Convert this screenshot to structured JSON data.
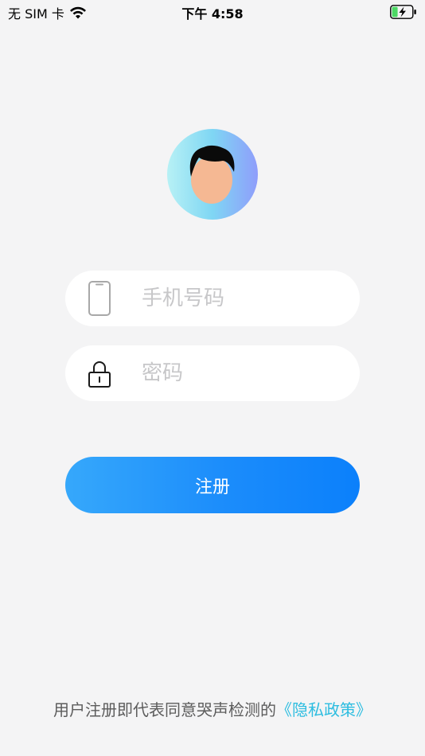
{
  "status_bar": {
    "carrier": "无 SIM 卡",
    "time": "下午 4:58",
    "battery_color": "#4cd964"
  },
  "form": {
    "phone_placeholder": "手机号码",
    "phone_value": "",
    "password_placeholder": "密码",
    "password_value": "",
    "register_label": "注册"
  },
  "footer": {
    "agreement_text": "用户注册即代表同意哭声检测的",
    "policy_link": "《隐私政策》"
  },
  "colors": {
    "background": "#f4f4f5",
    "button_gradient_start": "#36a8fb",
    "button_gradient_end": "#0b80fb",
    "link": "#2dbde0",
    "placeholder": "#c7c7c9"
  },
  "icons": [
    "wifi-icon",
    "battery-icon",
    "avatar-icon",
    "phone-icon",
    "lock-icon"
  ]
}
